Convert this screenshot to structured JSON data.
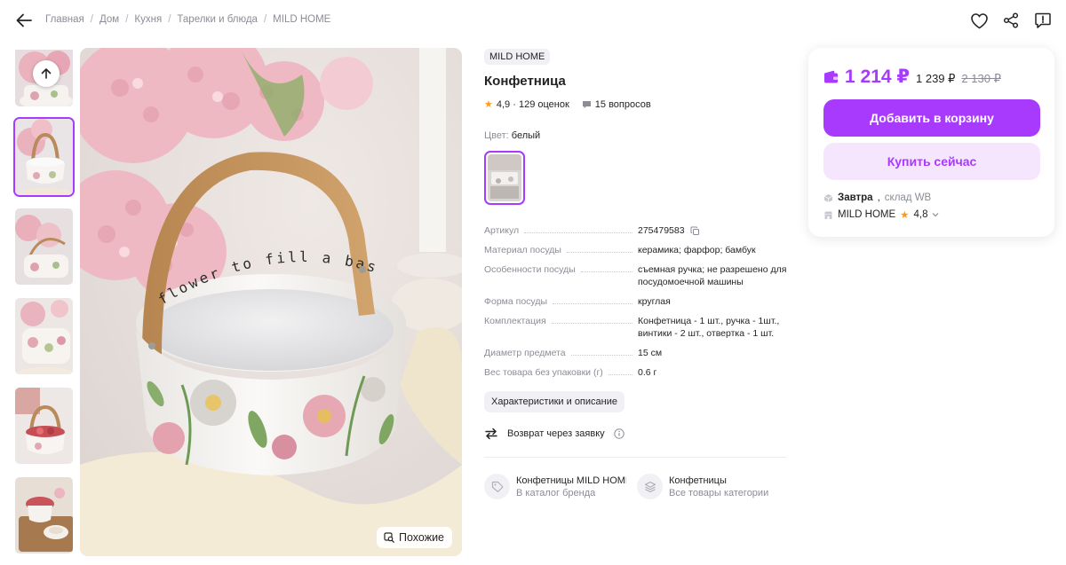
{
  "breadcrumbs": [
    "Главная",
    "Дом",
    "Кухня",
    "Тарелки и блюда",
    "MILD HOME"
  ],
  "icons": {
    "back": "arrow-left-icon",
    "favorite": "heart-icon",
    "share": "share-icon",
    "report": "report-icon"
  },
  "gallery": {
    "up_button": "arrow-up-icon",
    "similar_label": "Похожие",
    "main_text": "flower to fill a basket"
  },
  "product": {
    "brand": "MILD HOME",
    "title": "Конфетница",
    "rating": "4,9",
    "ratings_count": "· 129 оценок",
    "questions": "15 вопросов",
    "color_label": "Цвет:",
    "color_value": "белый"
  },
  "specs": [
    {
      "key": "Артикул",
      "value": "275479583"
    },
    {
      "key": "Материал посуды",
      "value": "керамика; фарфор; бамбук"
    },
    {
      "key": "Особенности посуды",
      "value": "съемная ручка; не разрешено для посудомоечной машины"
    },
    {
      "key": "Форма посуды",
      "value": "круглая"
    },
    {
      "key": "Комплектация",
      "value": "Конфетница - 1 шт., ручка - 1шт., винтики - 2 шт., отвертка - 1 шт."
    },
    {
      "key": "Диаметр предмета",
      "value": "15 см"
    },
    {
      "key": "Вес товара без упаковки (г)",
      "value": "0.6 г"
    }
  ],
  "specs_button": "Характеристики и описание",
  "return_text": "Возврат через заявку",
  "catalog_links": [
    {
      "title": "Конфетницы MILD HOME",
      "subtitle": "В каталог бренда"
    },
    {
      "title": "Конфетницы",
      "subtitle": "Все товары категории"
    }
  ],
  "price": {
    "current": "1 214 ₽",
    "regular": "1 239 ₽",
    "old": "2 130 ₽"
  },
  "buttons": {
    "add_to_cart": "Добавить в корзину",
    "buy_now": "Купить сейчас"
  },
  "delivery": {
    "day": "Завтра",
    "warehouse": "склад WB"
  },
  "seller": {
    "name": "MILD HOME",
    "rating": "4,8"
  },
  "colors": {
    "accent": "#a73afd",
    "accent_light": "#f5e5fd",
    "star": "#ff9a18",
    "muted": "#8c8c96"
  }
}
